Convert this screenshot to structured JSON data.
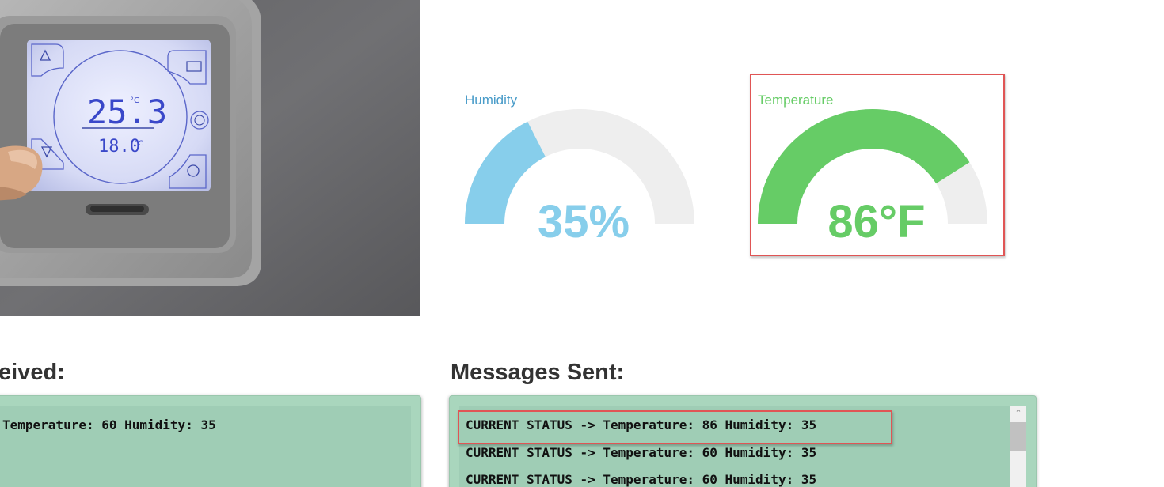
{
  "thermostat_image": {
    "current_temp": "25.3",
    "set_temp": "18.0",
    "unit": "°C"
  },
  "gauges": {
    "humidity": {
      "title": "Humidity",
      "value_text": "35%",
      "fraction": 0.35,
      "color": "#87ceeb",
      "track_color": "#eeeeee"
    },
    "temperature": {
      "title": "Temperature",
      "value_text": "86°F",
      "fraction": 0.82,
      "color": "#66cc66",
      "track_color": "#eeeeee"
    }
  },
  "received": {
    "heading": "eived:",
    "messages": [
      "Temperature: 60 Humidity: 35"
    ]
  },
  "sent": {
    "heading": "Messages Sent:",
    "messages": [
      "CURRENT STATUS -> Temperature: 86 Humidity: 35",
      "CURRENT STATUS -> Temperature: 60 Humidity: 35",
      "CURRENT STATUS -> Temperature: 60 Humidity: 35"
    ]
  },
  "colors": {
    "highlight": "#e05555",
    "panel_bg": "#a9d6bd",
    "heading": "#333333"
  }
}
